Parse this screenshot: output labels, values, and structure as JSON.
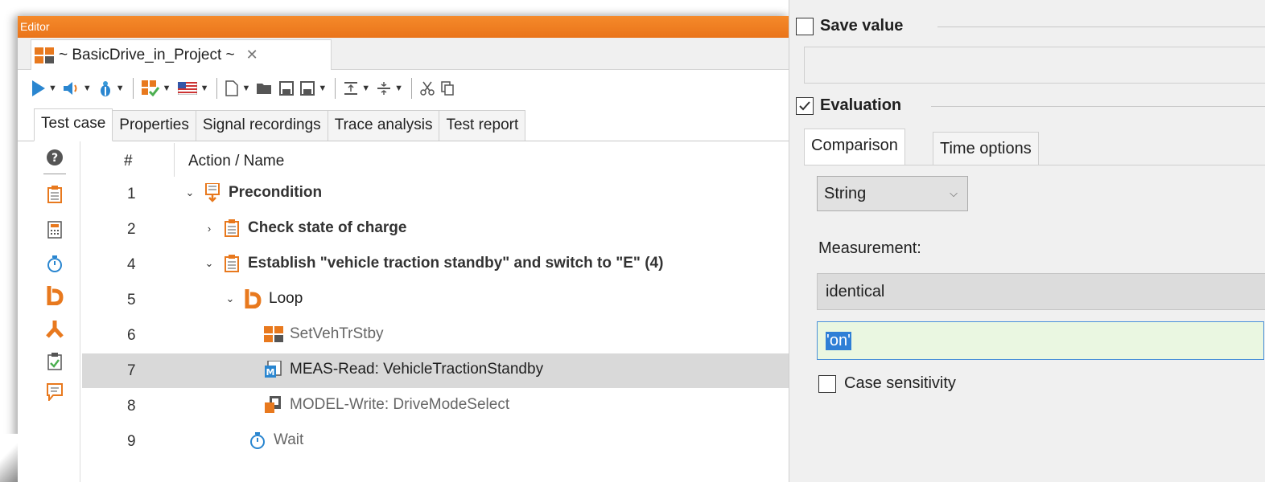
{
  "editor": {
    "title": "Editor",
    "doc_tab": {
      "label": "~ BasicDrive_in_Project ~",
      "close": "✕"
    },
    "view_tabs": [
      "Test case",
      "Properties",
      "Signal recordings",
      "Trace analysis",
      "Test report"
    ],
    "active_view_tab": 0,
    "tree": {
      "header": {
        "num": "#",
        "name": "Action / Name"
      },
      "rows": [
        {
          "num": "1",
          "label": "Precondition",
          "icon": "precondition-icon",
          "expander": "expanded",
          "style": "bold"
        },
        {
          "num": "2",
          "label": "Check state of charge",
          "icon": "package-icon",
          "expander": "collapsed",
          "style": "bold"
        },
        {
          "num": "4",
          "label": "Establish \"vehicle traction standby\" and switch to \"E\" (4)",
          "icon": "package-icon",
          "expander": "expanded",
          "style": "bold"
        },
        {
          "num": "5",
          "label": "Loop",
          "icon": "loop-icon",
          "expander": "expanded",
          "style": "normal"
        },
        {
          "num": "6",
          "label": "SetVehTrStby",
          "icon": "block-icon",
          "expander": "none",
          "style": "grey"
        },
        {
          "num": "7",
          "label": "MEAS-Read: VehicleTractionStandby",
          "icon": "meas-read-icon",
          "expander": "none",
          "style": "normal",
          "selected": true
        },
        {
          "num": "8",
          "label": "MODEL-Write: DriveModeSelect",
          "icon": "model-write-icon",
          "expander": "none",
          "style": "grey"
        },
        {
          "num": "9",
          "label": "Wait",
          "icon": "wait-icon",
          "expander": "none",
          "style": "grey"
        }
      ]
    },
    "side_icons": [
      "help-icon",
      "package-icon",
      "calculator-icon",
      "timer-icon",
      "loop-icon",
      "fork-icon",
      "check-icon",
      "comment-icon"
    ]
  },
  "properties": {
    "save_value": {
      "label": "Save value",
      "checked": false
    },
    "evaluation": {
      "label": "Evaluation",
      "checked": true
    },
    "tabs": [
      "Comparison",
      "Time options"
    ],
    "active_tab": 0,
    "type_select": {
      "value": "String",
      "caret": "⌵"
    },
    "measurement_label": "Measurement:",
    "operator_value": "identical",
    "value_input": "'on'",
    "case_sensitivity": {
      "label": "Case sensitivity",
      "checked": false
    }
  },
  "colors": {
    "accent_orange": "#f0801f",
    "selection_grey": "#d9d9d9",
    "input_green": "#eaf7e1",
    "focus_blue": "#4a90d9"
  }
}
